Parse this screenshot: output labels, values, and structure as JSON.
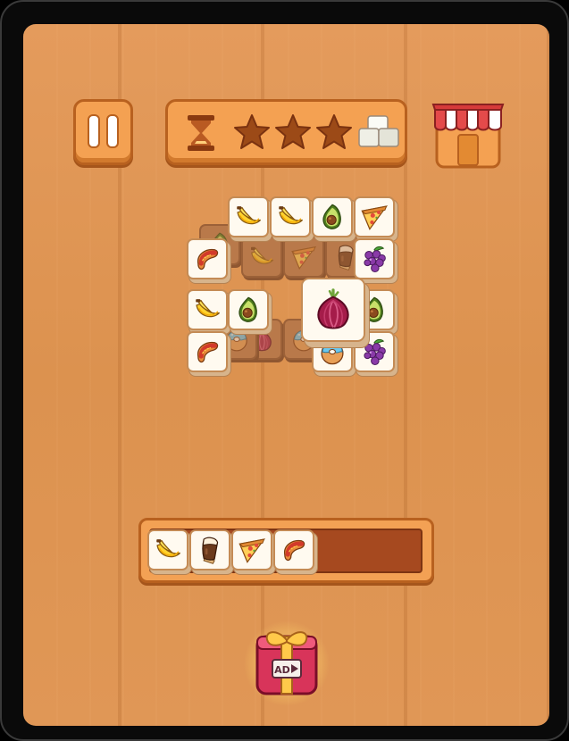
{
  "game": {
    "hud": {
      "pause_icon": "pause-icon",
      "timer_icon": "hourglass-icon",
      "stars": [
        1,
        2,
        3
      ],
      "block_icon": "sugar-cubes-icon",
      "shop_icon": "shop-icon"
    },
    "board": {
      "tiles_top_layer": [
        "banana",
        "banana",
        "avocado",
        "pizza",
        "sausage",
        "grapes",
        "banana",
        "avocado",
        "onion",
        "avocado",
        "sausage",
        "donut",
        "grapes"
      ],
      "tiles_under_layer": [
        "banana",
        "pizza",
        "popsicle",
        "onion",
        "donut"
      ]
    },
    "tray": {
      "capacity_slots": 7,
      "items": [
        "banana",
        "popsicle",
        "pizza",
        "sausage"
      ]
    },
    "reward": {
      "icon": "gift-box-icon",
      "label": "AD"
    }
  },
  "colors": {
    "wood": "#e09756",
    "button": "#f4a152",
    "button_border": "#b8611f",
    "tray_well": "#a6491f",
    "tile_face": "#fffaf0",
    "star": "#9c4a17"
  }
}
